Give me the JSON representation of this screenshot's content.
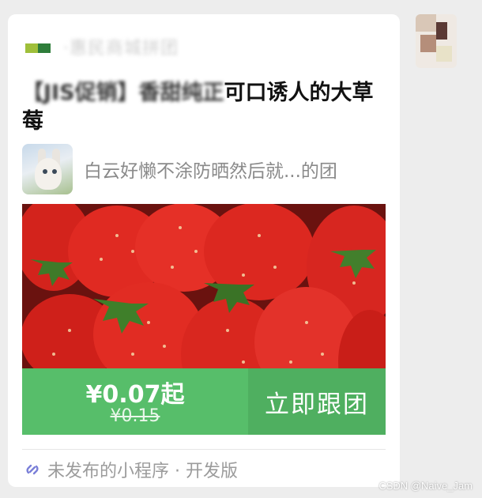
{
  "message_card": {
    "source_name": "·惠民商城拼团",
    "title_masked": "【JIS促销】香甜纯正",
    "title_visible": "可口诱人的大草莓",
    "group_name": "白云好懒不涂防晒然后就...的团",
    "price_now": "¥0.07起",
    "price_old": "¥0.15",
    "join_label": "立即跟团",
    "footer_label": "未发布的小程序 · 开发版",
    "accent_color": "#57be6a"
  },
  "icons": {
    "footer": "mini-program-link-icon"
  },
  "watermark": "CSDN @Naive_Jam"
}
